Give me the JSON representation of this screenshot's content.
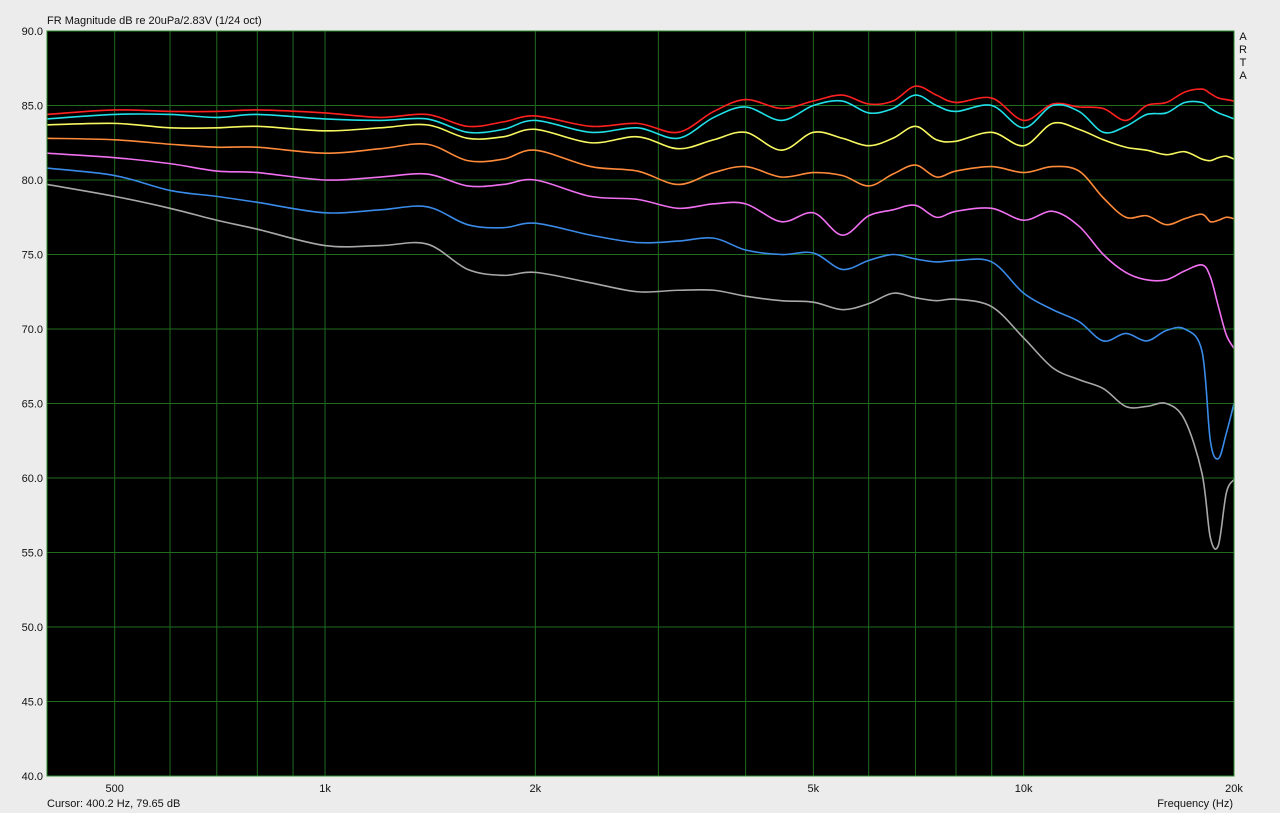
{
  "app": {
    "logo_letters": [
      "A",
      "R",
      "T",
      "A"
    ]
  },
  "status": {
    "cursor_text": "Cursor: 400.2 Hz, 79.65 dB"
  },
  "colors": {
    "background": "#000000",
    "grid": "#1f6b1f",
    "frame": "#2d8a2d",
    "window": "#ececec"
  },
  "chart_data": {
    "type": "line",
    "title": "FR Magnitude dB re 20uPa/2.83V (1/24 oct)",
    "xlabel": "Frequency (Hz)",
    "ylabel": "",
    "xscale": "log",
    "xlim": [
      400,
      20000
    ],
    "ylim": [
      40,
      90
    ],
    "yticks": [
      "90.0",
      "85.0",
      "80.0",
      "75.0",
      "70.0",
      "65.0",
      "60.0",
      "55.0",
      "50.0",
      "45.0",
      "40.0"
    ],
    "xticks": [
      {
        "value": 500,
        "label": "500"
      },
      {
        "value": 1000,
        "label": "1k"
      },
      {
        "value": 2000,
        "label": "2k"
      },
      {
        "value": 5000,
        "label": "5k"
      },
      {
        "value": 10000,
        "label": "10k"
      },
      {
        "value": 20000,
        "label": "20k"
      }
    ],
    "grid": true,
    "x": [
      400,
      500,
      600,
      700,
      800,
      1000,
      1200,
      1400,
      1600,
      1800,
      2000,
      2400,
      2800,
      3200,
      3600,
      4000,
      4500,
      5000,
      5500,
      6000,
      6500,
      7000,
      7500,
      8000,
      9000,
      10000,
      11000,
      12000,
      13000,
      14000,
      15000,
      16000,
      17000,
      18000,
      18500,
      19000,
      19500,
      20000
    ],
    "series": [
      {
        "color": "#ff2020",
        "values": [
          84.4,
          84.7,
          84.6,
          84.6,
          84.7,
          84.5,
          84.2,
          84.4,
          83.6,
          83.9,
          84.3,
          83.6,
          83.8,
          83.2,
          84.6,
          85.4,
          84.8,
          85.3,
          85.7,
          85.1,
          85.3,
          86.3,
          85.7,
          85.2,
          85.5,
          84.0,
          85.1,
          84.9,
          84.8,
          84.0,
          85.0,
          85.2,
          85.9,
          86.1,
          85.8,
          85.5,
          85.4,
          85.3
        ]
      },
      {
        "color": "#20e0e8",
        "values": [
          84.1,
          84.4,
          84.4,
          84.2,
          84.4,
          84.1,
          84.0,
          84.1,
          83.2,
          83.4,
          84.0,
          83.2,
          83.5,
          82.8,
          84.2,
          84.9,
          84.0,
          85.0,
          85.3,
          84.5,
          84.8,
          85.7,
          85.0,
          84.6,
          85.0,
          83.5,
          85.0,
          84.6,
          83.2,
          83.6,
          84.4,
          84.5,
          85.2,
          85.2,
          84.8,
          84.5,
          84.3,
          84.1
        ]
      },
      {
        "color": "#f8f860",
        "values": [
          83.7,
          83.8,
          83.5,
          83.5,
          83.6,
          83.3,
          83.5,
          83.7,
          82.8,
          82.9,
          83.4,
          82.5,
          82.9,
          82.1,
          82.7,
          83.2,
          82.0,
          83.2,
          82.8,
          82.3,
          82.8,
          83.6,
          82.7,
          82.6,
          83.2,
          82.3,
          83.8,
          83.4,
          82.7,
          82.2,
          82.0,
          81.7,
          81.9,
          81.4,
          81.3,
          81.5,
          81.6,
          81.4
        ]
      },
      {
        "color": "#ff8a3a",
        "values": [
          82.8,
          82.7,
          82.4,
          82.2,
          82.2,
          81.8,
          82.1,
          82.4,
          81.3,
          81.4,
          82.0,
          80.9,
          80.6,
          79.7,
          80.5,
          80.9,
          80.2,
          80.5,
          80.3,
          79.6,
          80.4,
          81.0,
          80.2,
          80.6,
          80.9,
          80.5,
          80.9,
          80.6,
          78.8,
          77.5,
          77.6,
          77.0,
          77.4,
          77.7,
          77.2,
          77.3,
          77.5,
          77.4
        ]
      },
      {
        "color": "#f070f0",
        "values": [
          81.8,
          81.5,
          81.1,
          80.6,
          80.5,
          80.0,
          80.2,
          80.4,
          79.6,
          79.7,
          80.0,
          78.9,
          78.7,
          78.1,
          78.4,
          78.4,
          77.2,
          77.8,
          76.3,
          77.6,
          78.0,
          78.3,
          77.5,
          77.9,
          78.1,
          77.3,
          77.9,
          76.9,
          75.0,
          73.8,
          73.3,
          73.3,
          73.9,
          74.3,
          73.5,
          71.5,
          69.6,
          68.7
        ]
      },
      {
        "color": "#3a8ae8",
        "values": [
          80.8,
          80.3,
          79.3,
          78.9,
          78.5,
          77.8,
          78.0,
          78.2,
          77.0,
          76.8,
          77.1,
          76.3,
          75.8,
          75.9,
          76.1,
          75.3,
          75.0,
          75.1,
          74.0,
          74.6,
          75.0,
          74.7,
          74.5,
          74.6,
          74.5,
          72.4,
          71.3,
          70.5,
          69.2,
          69.7,
          69.2,
          69.9,
          70.0,
          68.5,
          62.5,
          61.3,
          63.0,
          65.0
        ]
      },
      {
        "color": "#a8a8a8",
        "values": [
          79.7,
          78.9,
          78.1,
          77.3,
          76.7,
          75.6,
          75.6,
          75.7,
          74.0,
          73.6,
          73.8,
          73.1,
          72.5,
          72.6,
          72.6,
          72.2,
          71.9,
          71.8,
          71.3,
          71.7,
          72.4,
          72.1,
          71.9,
          72.0,
          71.5,
          69.4,
          67.4,
          66.6,
          66.0,
          64.8,
          64.8,
          65.0,
          63.9,
          60.3,
          56.0,
          55.5,
          59.0,
          59.9
        ]
      }
    ]
  }
}
